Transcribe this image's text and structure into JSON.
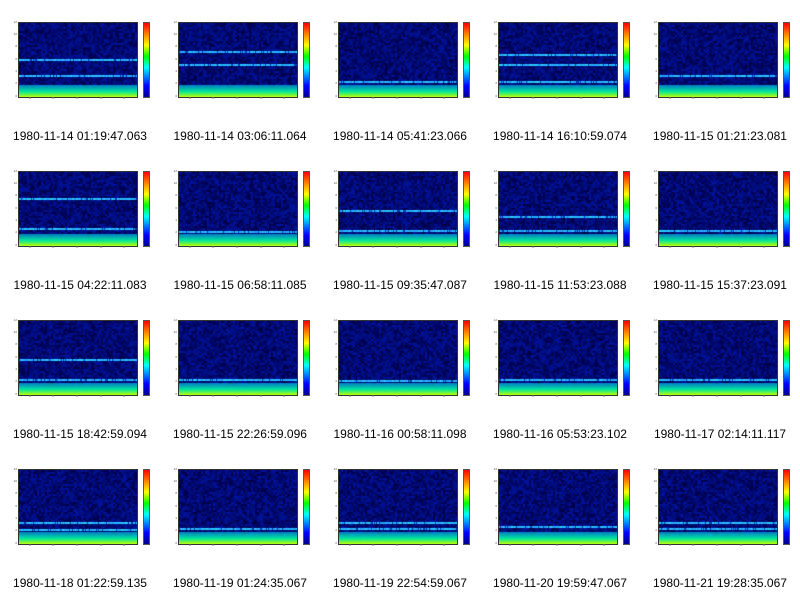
{
  "tiles": [
    {
      "caption": "1980-11-14 01:19:47.063",
      "bands": [
        0.52,
        0.3
      ]
    },
    {
      "caption": "1980-11-14 03:06:11.064",
      "bands": [
        0.62,
        0.45
      ]
    },
    {
      "caption": "1980-11-14 05:41:23.066",
      "bands": [
        0.22
      ]
    },
    {
      "caption": "1980-11-14 16:10:59.074",
      "bands": [
        0.58,
        0.45,
        0.22
      ]
    },
    {
      "caption": "1980-11-15 01:21:23.081",
      "bands": [
        0.3
      ]
    },
    {
      "caption": "1980-11-15 04:22:11.083",
      "bands": [
        0.65,
        0.25
      ]
    },
    {
      "caption": "1980-11-15 06:58:11.085",
      "bands": [
        0.2
      ]
    },
    {
      "caption": "1980-11-15 09:35:47.087",
      "bands": [
        0.48,
        0.22
      ]
    },
    {
      "caption": "1980-11-15 11:53:23.088",
      "bands": [
        0.4,
        0.22
      ]
    },
    {
      "caption": "1980-11-15 15:37:23.091",
      "bands": [
        0.22
      ]
    },
    {
      "caption": "1980-11-15 18:42:59.094",
      "bands": [
        0.48,
        0.22
      ]
    },
    {
      "caption": "1980-11-15 22:26:59.096",
      "bands": [
        0.22
      ]
    },
    {
      "caption": "1980-11-16 00:58:11.098",
      "bands": [
        0.2
      ]
    },
    {
      "caption": "1980-11-16 05:53:23.102",
      "bands": [
        0.22
      ]
    },
    {
      "caption": "1980-11-17 02:14:11.117",
      "bands": [
        0.22
      ]
    },
    {
      "caption": "1980-11-18 01:22:59.135",
      "bands": [
        0.3,
        0.2
      ]
    },
    {
      "caption": "1980-11-19 01:24:35.067",
      "bands": [
        0.22
      ]
    },
    {
      "caption": "1980-11-19 22:54:59.067",
      "bands": [
        0.3,
        0.22
      ]
    },
    {
      "caption": "1980-11-20 19:59:47.067",
      "bands": [
        0.25
      ]
    },
    {
      "caption": "1980-11-21 19:28:35.067",
      "bands": [
        0.3,
        0.22
      ]
    }
  ]
}
